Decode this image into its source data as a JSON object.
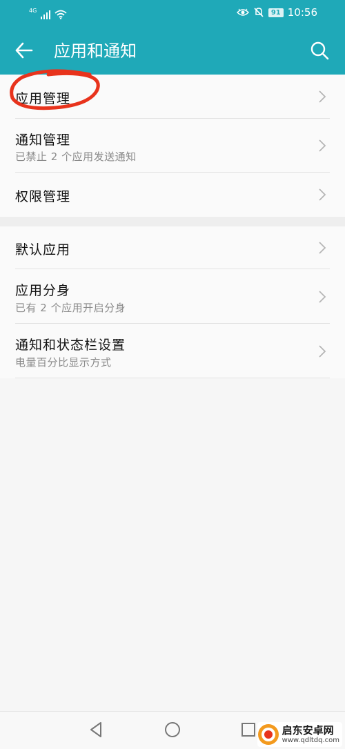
{
  "status_bar": {
    "network": "4G",
    "battery": "91",
    "time": "10:56"
  },
  "app_bar": {
    "title": "应用和通知"
  },
  "groups": [
    {
      "items": [
        {
          "title": "应用管理",
          "subtitle": ""
        },
        {
          "title": "通知管理",
          "subtitle": "已禁止 2 个应用发送通知"
        },
        {
          "title": "权限管理",
          "subtitle": ""
        }
      ]
    },
    {
      "items": [
        {
          "title": "默认应用",
          "subtitle": ""
        },
        {
          "title": "应用分身",
          "subtitle": "已有 2 个应用开启分身"
        },
        {
          "title": "通知和状态栏设置",
          "subtitle": "电量百分比显示方式"
        }
      ]
    }
  ],
  "annotation": {
    "color": "#e8331c"
  },
  "watermark": {
    "name": "启东安卓网",
    "url": "www.qdltdq.com"
  },
  "colors": {
    "accent": "#1fa9b8",
    "background": "#f6f6f6"
  }
}
